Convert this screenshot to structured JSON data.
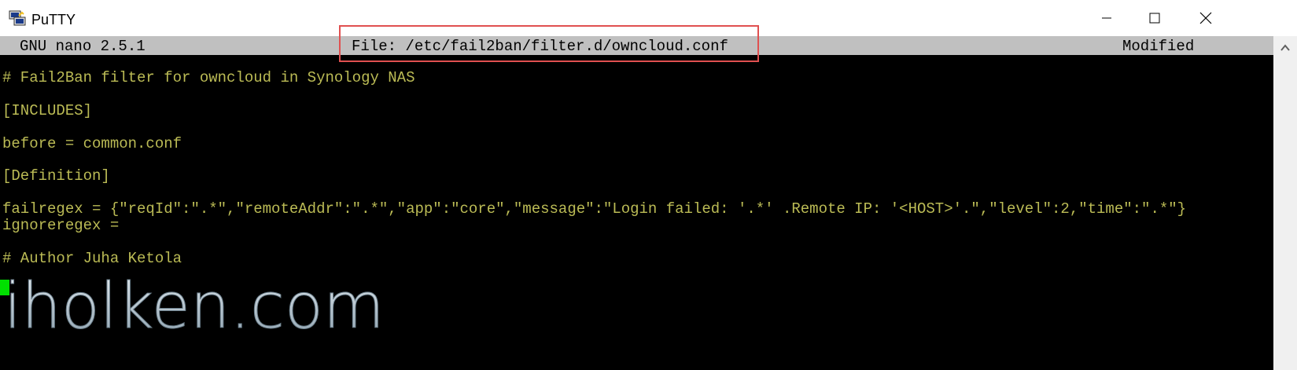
{
  "window": {
    "title": "PuTTY",
    "icons": {
      "app": "putty-icon",
      "minimize": "minimize-icon",
      "maximize": "maximize-icon",
      "close": "close-icon"
    }
  },
  "nano": {
    "version": "GNU nano 2.5.1",
    "file": "File: /etc/fail2ban/filter.d/owncloud.conf",
    "state": "Modified"
  },
  "content": {
    "lines": [
      "# Fail2Ban filter for owncloud in Synology NAS",
      "[INCLUDES]",
      "before = common.conf",
      "[Definition]",
      "failregex = {\"reqId\":\".*\",\"remoteAddr\":\".*\",\"app\":\"core\",\"message\":\"Login failed: '.*' .Remote IP: '<HOST>'.\",\"level\":2,\"time\":\".*\"}",
      "ignoreregex =",
      "# Author Juha Ketola"
    ]
  },
  "watermark": {
    "text": "iholken.com"
  },
  "colors": {
    "terminal_bg": "#000000",
    "terminal_text": "#bbbb55",
    "status_bar_bg": "#c0c0c0",
    "cursor": "#00e000",
    "highlight_box": "#e05050"
  }
}
